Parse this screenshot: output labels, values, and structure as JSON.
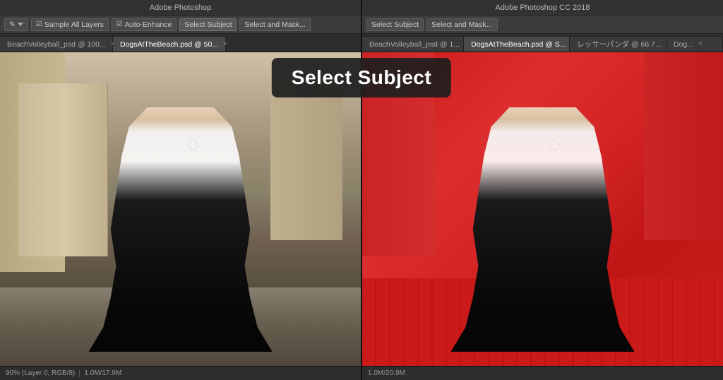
{
  "app": {
    "title_left": "Adobe Photoshop",
    "title_right": "Adobe Photoshop CC 2018"
  },
  "toolbar_left": {
    "sample_all_layers_label": "Sample All Layers",
    "auto_enhance_label": "Auto-Enhance",
    "select_subject_label": "Select Subject",
    "select_and_mask_label": "Select and Mask..."
  },
  "toolbar_right": {
    "select_subject_label": "Select Subject",
    "select_and_mask_label": "Select and Mask..."
  },
  "tabs_left": [
    {
      "label": "BeachVolleyball_psd @ 100...",
      "close": "×",
      "active": false
    },
    {
      "label": "DogsAtTheBeach.psd @ 50...",
      "close": "×",
      "active": true
    }
  ],
  "tabs_right": [
    {
      "label": "BeachVolleyball_psd @ 1...",
      "close": "×",
      "active": false
    },
    {
      "label": "DogsAtTheBeach.psd @ S...",
      "close": "×",
      "active": false
    },
    {
      "label": "レッサーパンダ @ 66.7...",
      "close": "×",
      "active": false
    },
    {
      "label": "Dog...",
      "close": "×",
      "active": false
    }
  ],
  "tooltip": {
    "title": "Select Subject"
  },
  "status_left": {
    "zoom": "90% (Layer 0, RGB/8)",
    "file_size": "1.0M/17.9M"
  },
  "status_right": {
    "zoom": "1.0M/20.9M"
  },
  "circles": {
    "left_circle": "○",
    "right_circle": "○"
  }
}
